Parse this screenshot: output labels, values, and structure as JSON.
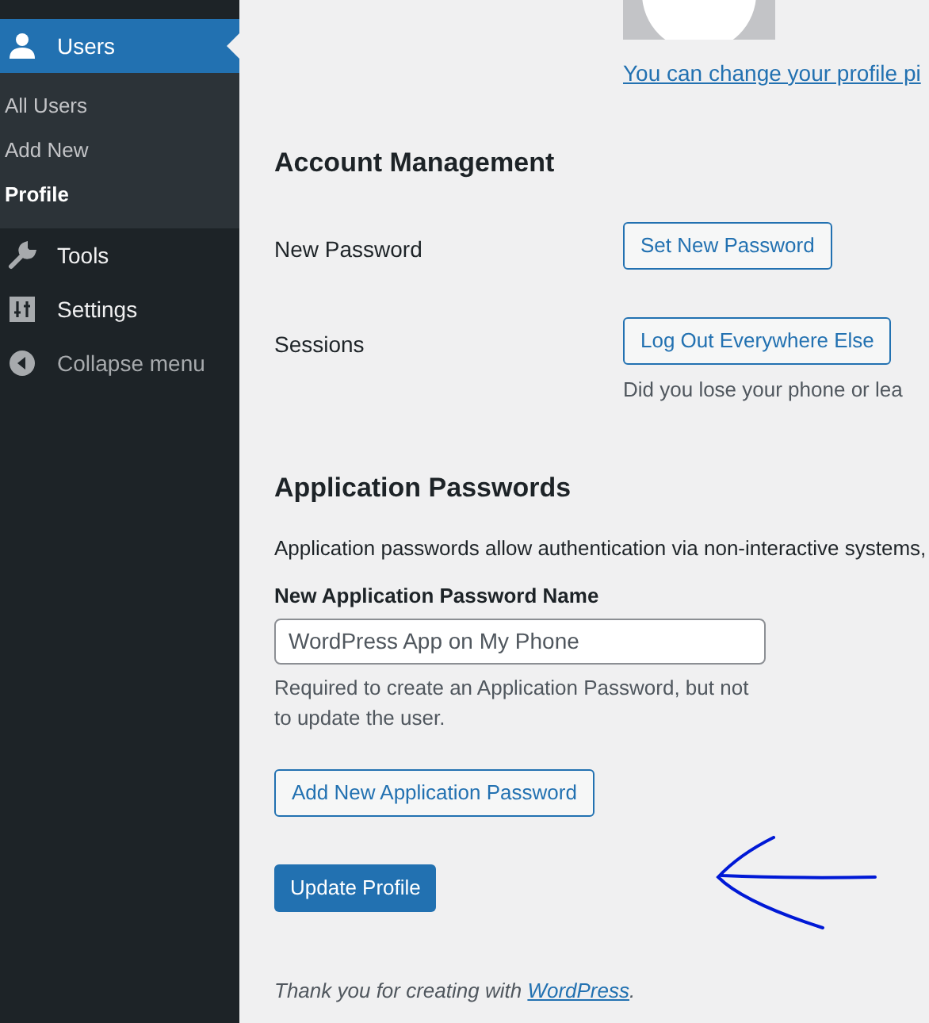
{
  "sidebar": {
    "items": [
      {
        "label": "Users",
        "kind": "user",
        "selected": true,
        "children": [
          {
            "label": "All Users",
            "selected": false
          },
          {
            "label": "Add New",
            "selected": false
          },
          {
            "label": "Profile",
            "selected": true
          }
        ]
      },
      {
        "label": "Tools",
        "kind": "wrench",
        "selected": false
      },
      {
        "label": "Settings",
        "kind": "sliders",
        "selected": false
      },
      {
        "label": "Collapse menu",
        "kind": "collapse",
        "selected": false
      }
    ]
  },
  "profile_picture": {
    "link": "You can change your profile pi"
  },
  "account_management": {
    "heading": "Account Management",
    "rows": [
      {
        "label": "New Password",
        "button": "Set New Password"
      },
      {
        "label": "Sessions",
        "button": "Log Out Everywhere Else",
        "description": "Did you lose your phone or lea"
      }
    ]
  },
  "application_passwords": {
    "heading": "Application Passwords",
    "description": "Application passwords allow authentication via non-interactive systems,",
    "field_label": "New Application Password Name",
    "placeholder": "WordPress App on My Phone",
    "help": "Required to create an Application Password, but not to update the user.",
    "button": "Add New Application Password"
  },
  "update_button": "Update Profile",
  "footer": {
    "text": "Thank you for creating with ",
    "link": "WordPress",
    "after": "."
  }
}
